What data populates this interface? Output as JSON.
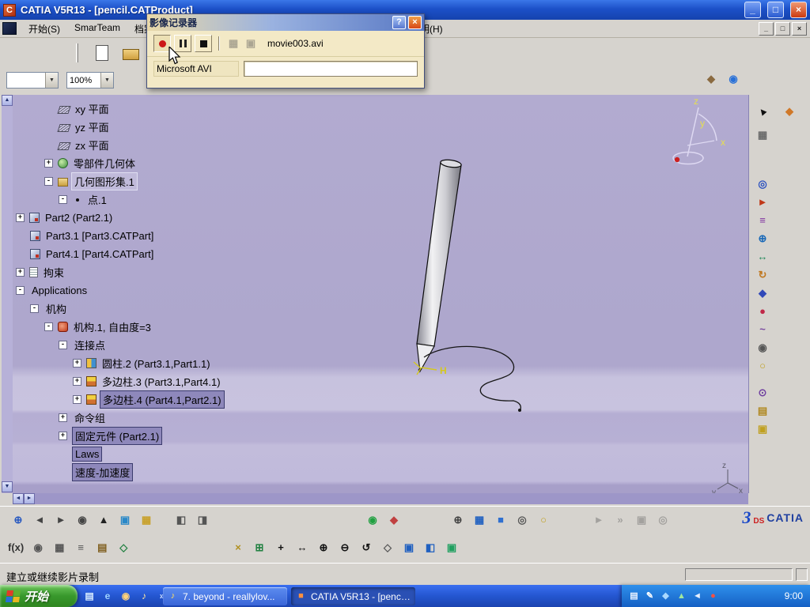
{
  "colors": {
    "titlebar_blue": "#1c50c8",
    "taskbar_green": "#38982c",
    "viewport_lavender": "#aea7cd",
    "selection": "#8e88bb",
    "dialog_cream": "#f3e9c6",
    "catia_blue": "#2040a0",
    "catia_red": "#cc2020"
  },
  "titlebar": {
    "title": "CATIA V5R13 - [pencil.CATProduct]",
    "minimize": "_",
    "maximize": "□",
    "close": "×"
  },
  "menubar": {
    "items": [
      {
        "label": "开始(S)"
      },
      {
        "label": "SmarTeam"
      },
      {
        "label": "档案(F)"
      }
    ],
    "help": "说明(H)",
    "mdi": {
      "minimize": "_",
      "restore": "□",
      "close": "×"
    }
  },
  "toolbar": {
    "view_combo_value": "",
    "zoom_combo_value": "100%",
    "right_icons": [
      {
        "name": "brush-icon",
        "glyph": "◆",
        "color": "#8a6a40"
      },
      {
        "name": "globe-icon",
        "glyph": "◉",
        "color": "#2870d8"
      }
    ]
  },
  "dialog": {
    "title": "影像记录器",
    "help_glyph": "?",
    "close_glyph": "×",
    "filename": "movie003.avi",
    "format_label": "Microsoft AVI",
    "input_value": "",
    "disabled_icons": [
      {
        "name": "film-icon",
        "glyph": "▦",
        "color": "#555555"
      },
      {
        "name": "camera-icon",
        "glyph": "▣",
        "color": "#555555"
      }
    ]
  },
  "tree": {
    "items": [
      {
        "label": "xy 平面",
        "depth": 3,
        "exp": "no",
        "icon": "plane",
        "sel": false,
        "boxed": false
      },
      {
        "label": "yz 平面",
        "depth": 3,
        "exp": "no",
        "icon": "plane",
        "sel": false,
        "boxed": false
      },
      {
        "label": "zx 平面",
        "depth": 3,
        "exp": "no",
        "icon": "plane",
        "sel": false,
        "boxed": false
      },
      {
        "label": "零部件几何体",
        "depth": 2,
        "exp": "plus",
        "icon": "gear",
        "sel": false,
        "boxed": false
      },
      {
        "label": "几何图形集.1",
        "depth": 2,
        "exp": "minus",
        "icon": "geoset",
        "sel": false,
        "boxed": true
      },
      {
        "label": "点.1",
        "depth": 3,
        "exp": "minus",
        "icon": "point",
        "sel": false,
        "boxed": false
      },
      {
        "label": "Part2 (Part2.1)",
        "depth": 0,
        "exp": "plus",
        "icon": "part",
        "sel": false,
        "boxed": false
      },
      {
        "label": "Part3.1 [Part3.CATPart]",
        "depth": 1,
        "exp": "no",
        "icon": "part",
        "sel": false,
        "boxed": false
      },
      {
        "label": "Part4.1 [Part4.CATPart]",
        "depth": 1,
        "exp": "no",
        "icon": "part",
        "sel": false,
        "boxed": false
      },
      {
        "label": "拘束",
        "depth": 0,
        "exp": "plus",
        "icon": "constraint",
        "sel": false,
        "boxed": false
      },
      {
        "label": "Applications",
        "depth": 0,
        "exp": "minus",
        "icon": "none",
        "sel": false,
        "boxed": false
      },
      {
        "label": "机构",
        "depth": 1,
        "exp": "minus",
        "icon": "none",
        "sel": false,
        "boxed": false
      },
      {
        "label": "机构.1, 自由度=3",
        "depth": 2,
        "exp": "minus",
        "icon": "mech",
        "sel": false,
        "boxed": false
      },
      {
        "label": "连接点",
        "depth": 3,
        "exp": "minus",
        "icon": "none",
        "sel": false,
        "boxed": false
      },
      {
        "label": "圆柱.2 (Part3.1,Part1.1)",
        "depth": 4,
        "exp": "plus",
        "icon": "cyl",
        "sel": false,
        "boxed": false
      },
      {
        "label": "多边柱.3 (Part3.1,Part4.1)",
        "depth": 4,
        "exp": "plus",
        "icon": "poly",
        "sel": false,
        "boxed": false
      },
      {
        "label": "多边柱.4 (Part4.1,Part2.1)",
        "depth": 4,
        "exp": "plus",
        "icon": "poly",
        "sel": true,
        "boxed": false
      },
      {
        "label": "命令组",
        "depth": 3,
        "exp": "plus",
        "icon": "none",
        "sel": false,
        "boxed": false
      },
      {
        "label": "固定元件 (Part2.1)",
        "depth": 3,
        "exp": "plus",
        "icon": "none",
        "sel": true,
        "boxed": false
      },
      {
        "label": "Laws",
        "depth": 3,
        "exp": "blank",
        "icon": "none",
        "sel": true,
        "boxed": false
      },
      {
        "label": "速度-加速度",
        "depth": 3,
        "exp": "blank",
        "icon": "none",
        "sel": true,
        "boxed": false
      }
    ]
  },
  "viewport": {
    "compass": {
      "x": "x",
      "y": "y",
      "z": "z"
    },
    "triad": {
      "x": "x",
      "y": "y",
      "z": "z"
    },
    "pencil_label": "H"
  },
  "scrollbars": {
    "up": "▲",
    "down": "▼",
    "left": "◄",
    "right": "►"
  },
  "right_toolbar": {
    "g1": [
      {
        "name": "select-cursor-icon",
        "glyph": "▲",
        "color": "#111111"
      },
      {
        "name": "smarteam-users-icon",
        "glyph": "◆",
        "color": "#d07828"
      }
    ],
    "g2": [
      {
        "name": "toolbox-icon",
        "glyph": "▦",
        "color": "#6a6a6a"
      }
    ],
    "g3": [
      {
        "name": "simulation-icon",
        "glyph": "◎",
        "color": "#2a50c0"
      },
      {
        "name": "replay-icon",
        "glyph": "►",
        "color": "#c03818"
      },
      {
        "name": "sequence-icon",
        "glyph": "≡",
        "color": "#8030a0"
      },
      {
        "name": "measure-icon",
        "glyph": "⊕",
        "color": "#1868b8"
      },
      {
        "name": "distance-icon",
        "glyph": "↔",
        "color": "#208858"
      },
      {
        "name": "track-icon",
        "glyph": "↻",
        "color": "#c07820"
      },
      {
        "name": "swept-volume-icon",
        "glyph": "◆",
        "color": "#3048b8"
      },
      {
        "name": "clash-icon",
        "glyph": "●",
        "color": "#c02848"
      },
      {
        "name": "spline-icon",
        "glyph": "~",
        "color": "#7a4aa0"
      },
      {
        "name": "camera-icon",
        "glyph": "◉",
        "color": "#555555"
      },
      {
        "name": "light-icon",
        "glyph": "○",
        "color": "#c0a020"
      }
    ],
    "g4": [
      {
        "name": "annotation-icon",
        "glyph": "⊙",
        "color": "#7040a0"
      },
      {
        "name": "mailbox-icon",
        "glyph": "▤",
        "color": "#b08820"
      },
      {
        "name": "report-icon",
        "glyph": "▣",
        "color": "#c0a020"
      }
    ]
  },
  "bottom1": {
    "left": [
      {
        "name": "fly-through-icon",
        "glyph": "⊕",
        "color": "#2a5ac0"
      },
      {
        "name": "rewind-icon",
        "glyph": "◄",
        "color": "#444444"
      },
      {
        "name": "forward-icon",
        "glyph": "►",
        "color": "#444444"
      },
      {
        "name": "magnify-icon",
        "glyph": "◉",
        "color": "#444444"
      },
      {
        "name": "pointer-icon",
        "glyph": "▲",
        "color": "#222222"
      },
      {
        "name": "render-style-icon",
        "glyph": "▣",
        "color": "#2a88c8"
      },
      {
        "name": "texture-icon",
        "glyph": "▦",
        "color": "#c8a028"
      }
    ],
    "mid": [
      {
        "name": "dock-left-icon",
        "glyph": "◧",
        "color": "#555555"
      },
      {
        "name": "dock-right-icon",
        "glyph": "◨",
        "color": "#555555"
      }
    ],
    "center": [
      {
        "name": "update-icon",
        "glyph": "◉",
        "color": "#20a040"
      },
      {
        "name": "material-icon",
        "glyph": "◆",
        "color": "#c04040"
      }
    ],
    "view": [
      {
        "name": "compass-icon",
        "glyph": "⊕",
        "color": "#444444"
      },
      {
        "name": "grid-icon",
        "glyph": "▦",
        "color": "#2060c0"
      },
      {
        "name": "box-icon",
        "glyph": "■",
        "color": "#3070d0"
      },
      {
        "name": "gear-icon",
        "glyph": "◎",
        "color": "#555555"
      },
      {
        "name": "bulb-icon",
        "glyph": "○",
        "color": "#c0a020"
      }
    ],
    "faded": [
      {
        "name": "play-icon",
        "glyph": "►",
        "color": "#666666"
      },
      {
        "name": "fast-forward-icon",
        "glyph": "»",
        "color": "#666666"
      },
      {
        "name": "frame-icon",
        "glyph": "▣",
        "color": "#666666"
      },
      {
        "name": "loop-icon",
        "glyph": "◎",
        "color": "#666666"
      }
    ],
    "logo": {
      "three": "3",
      "ds": "DS",
      "catia": "CATIA"
    }
  },
  "bottom2": {
    "left": [
      {
        "name": "fx-icon",
        "glyph": "f(x)",
        "color": "#333333"
      },
      {
        "name": "eye-icon",
        "glyph": "◉",
        "color": "#555555"
      },
      {
        "name": "design-table-icon",
        "glyph": "▦",
        "color": "#555555"
      },
      {
        "name": "relations-icon",
        "glyph": "≡",
        "color": "#555555"
      },
      {
        "name": "catalog-book-icon",
        "glyph": "▤",
        "color": "#806020"
      },
      {
        "name": "check-icon",
        "glyph": "◇",
        "color": "#208040"
      }
    ],
    "nav": [
      {
        "name": "escape-icon",
        "glyph": "×",
        "color": "#b09020"
      },
      {
        "name": "multi-view-icon",
        "glyph": "⊞",
        "color": "#208040"
      },
      {
        "name": "pan-icon",
        "glyph": "+",
        "color": "#111111"
      },
      {
        "name": "fit-all-icon",
        "glyph": "↔",
        "color": "#111111"
      },
      {
        "name": "zoom-in-icon",
        "glyph": "⊕",
        "color": "#111111"
      },
      {
        "name": "zoom-out-icon",
        "glyph": "⊖",
        "color": "#111111"
      },
      {
        "name": "rotate-icon",
        "glyph": "↺",
        "color": "#111111"
      },
      {
        "name": "normal-view-icon",
        "glyph": "◇",
        "color": "#555555"
      },
      {
        "name": "iso-view-icon",
        "glyph": "▣",
        "color": "#2060c0"
      },
      {
        "name": "shade-icon",
        "glyph": "◧",
        "color": "#2060c0"
      },
      {
        "name": "wireframe-icon",
        "glyph": "▣",
        "color": "#20a060"
      }
    ]
  },
  "statusbar": {
    "message": "建立或继续影片录制"
  },
  "taskbar": {
    "start_label": "开始",
    "quick_launch": [
      {
        "name": "show-desktop-icon",
        "glyph": "▤",
        "color": "#d8ecff"
      },
      {
        "name": "ie-icon",
        "glyph": "e",
        "color": "#9fd4ff"
      },
      {
        "name": "media-player-icon",
        "glyph": "◉",
        "color": "#ffd27a"
      },
      {
        "name": "music-icon",
        "glyph": "♪",
        "color": "#ffe8a0"
      }
    ],
    "chevron": "»",
    "tasks": [
      {
        "label": "7. beyond - reallylov...",
        "glyph": "♪",
        "color": "#ffe060",
        "pressed": false
      },
      {
        "label": "CATIA V5R13 - [penci...",
        "glyph": "■",
        "color": "#ff9040",
        "pressed": true
      }
    ],
    "tray_icons": [
      {
        "name": "ime-icon",
        "glyph": "▤",
        "color": "#eaf2ff"
      },
      {
        "name": "tablet-pen-icon",
        "glyph": "✎",
        "color": "#ffffff"
      },
      {
        "name": "messenger-icon",
        "glyph": "◆",
        "color": "#a8d8ff"
      },
      {
        "name": "shield-icon",
        "glyph": "▲",
        "color": "#9fe89f"
      },
      {
        "name": "volume-icon",
        "glyph": "◄",
        "color": "#e8f0ff"
      },
      {
        "name": "recording-alert-icon",
        "glyph": "●",
        "color": "#ff5040"
      }
    ],
    "clock": "9:00"
  }
}
